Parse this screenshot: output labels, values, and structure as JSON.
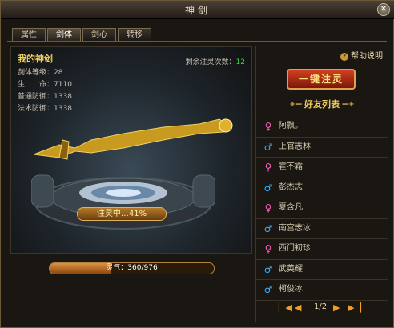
{
  "window": {
    "title": "神剑"
  },
  "tabs": [
    {
      "label": "属性",
      "active": false
    },
    {
      "label": "剑体",
      "active": true
    },
    {
      "label": "剑心",
      "active": false
    },
    {
      "label": "转移",
      "active": false
    }
  ],
  "sword": {
    "name": "我的神剑",
    "stats": [
      {
        "label": "剑体等级：",
        "value": "28"
      },
      {
        "label": "生　　命：",
        "value": "7110"
      },
      {
        "label": "普通防御：",
        "value": "1338"
      },
      {
        "label": "法术防御：",
        "value": "1338"
      }
    ],
    "remain_label": "剩余注灵次数：",
    "remain_value": "12",
    "infuse_text": "注灵中…41%",
    "infuse_progress": 0.41,
    "qi_text": "灵气：360/976",
    "qi_progress": 0.369
  },
  "right": {
    "help_label": "帮助说明",
    "one_key_label": "一键注灵",
    "friends_title": "好友列表",
    "friends": [
      {
        "name": "阿飘。",
        "gender": "female"
      },
      {
        "name": "上官志林",
        "gender": "male"
      },
      {
        "name": "霍不霜",
        "gender": "female"
      },
      {
        "name": "彭杰志",
        "gender": "male"
      },
      {
        "name": "夏含凡",
        "gender": "female"
      },
      {
        "name": "南宫志冰",
        "gender": "male"
      },
      {
        "name": "西门初珍",
        "gender": "female"
      },
      {
        "name": "武英耀",
        "gender": "male"
      },
      {
        "name": "柯俊冰",
        "gender": "male"
      }
    ],
    "page_text": "1/2"
  },
  "colors": {
    "gold": "#f0d060",
    "male": "#40b0ff",
    "female": "#ff60c0",
    "green": "#48d048"
  }
}
